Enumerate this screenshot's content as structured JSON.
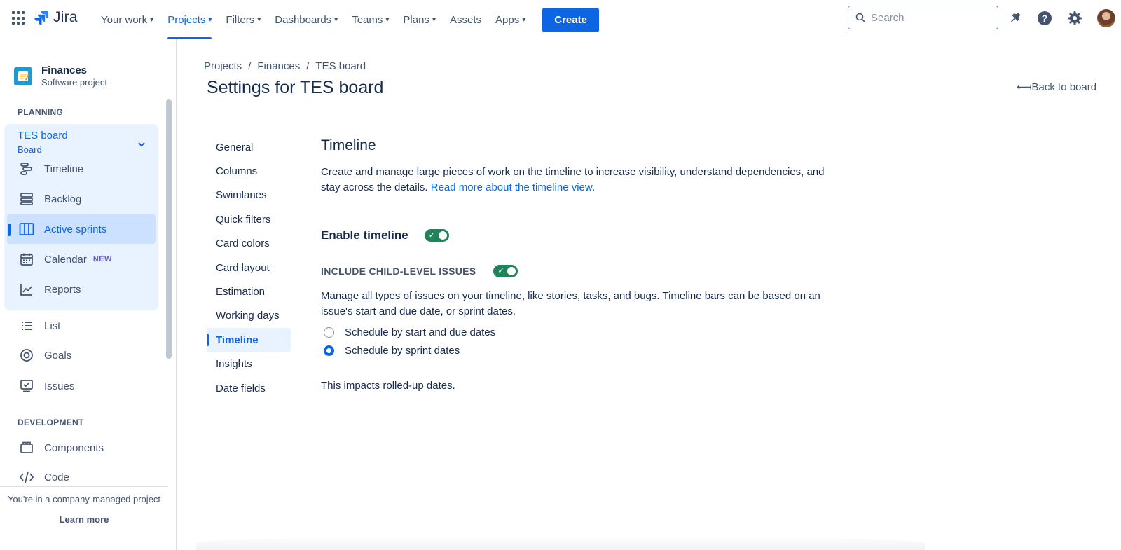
{
  "nav": {
    "logo_text": "Jira",
    "items": [
      {
        "label": "Your work",
        "chevron": true
      },
      {
        "label": "Projects",
        "chevron": true,
        "active": true
      },
      {
        "label": "Filters",
        "chevron": true
      },
      {
        "label": "Dashboards",
        "chevron": true
      },
      {
        "label": "Teams",
        "chevron": true
      },
      {
        "label": "Plans",
        "chevron": true
      },
      {
        "label": "Assets",
        "chevron": false
      },
      {
        "label": "Apps",
        "chevron": true
      }
    ],
    "create_label": "Create",
    "search_placeholder": "Search",
    "accent": "#0c66e4"
  },
  "sidebar": {
    "project_name": "Finances",
    "project_type": "Software project",
    "planning_label": "PLANNING",
    "board_title": "TES board",
    "board_sub": "Board",
    "planning_items": [
      {
        "label": "Timeline",
        "icon": "timeline-icon"
      },
      {
        "label": "Backlog",
        "icon": "backlog-icon"
      },
      {
        "label": "Active sprints",
        "icon": "board-columns-icon",
        "selected": true
      },
      {
        "label": "Calendar",
        "icon": "calendar-icon",
        "badge": "NEW"
      },
      {
        "label": "Reports",
        "icon": "reports-icon"
      }
    ],
    "other_items": [
      {
        "label": "List",
        "icon": "list-icon"
      },
      {
        "label": "Goals",
        "icon": "goals-icon"
      },
      {
        "label": "Issues",
        "icon": "issues-icon"
      }
    ],
    "development_label": "DEVELOPMENT",
    "dev_items": [
      {
        "label": "Components",
        "icon": "components-icon"
      },
      {
        "label": "Code",
        "icon": "code-icon"
      }
    ],
    "footer_note": "You're in a company-managed project",
    "footer_link": "Learn more"
  },
  "main": {
    "breadcrumbs": [
      "Projects",
      "Finances",
      "TES board"
    ],
    "title": "Settings for TES board",
    "back_link": "Back to board",
    "settings_nav": [
      "General",
      "Columns",
      "Swimlanes",
      "Quick filters",
      "Card colors",
      "Card layout",
      "Estimation",
      "Working days",
      "Timeline",
      "Insights",
      "Date fields"
    ],
    "settings_active": "Timeline",
    "section_title": "Timeline",
    "description": "Create and manage large pieces of work on the timeline to increase visibility, understand dependencies, and stay across the details.",
    "description_link": "Read more about the timeline view",
    "description_end": ".",
    "enable_label": "Enable timeline",
    "enable_on": true,
    "child_label": "INCLUDE CHILD-LEVEL ISSUES",
    "child_on": true,
    "child_description": "Manage all types of issues on your timeline, like stories, tasks, and bugs. Timeline bars can be based on an issue's start and due date, or sprint dates.",
    "radio_options": [
      "Schedule by start and due dates",
      "Schedule by sprint dates"
    ],
    "radio_selected": "Schedule by sprint dates",
    "impact_note": "This impacts rolled-up dates.",
    "toggle_color": "#1f845a"
  }
}
